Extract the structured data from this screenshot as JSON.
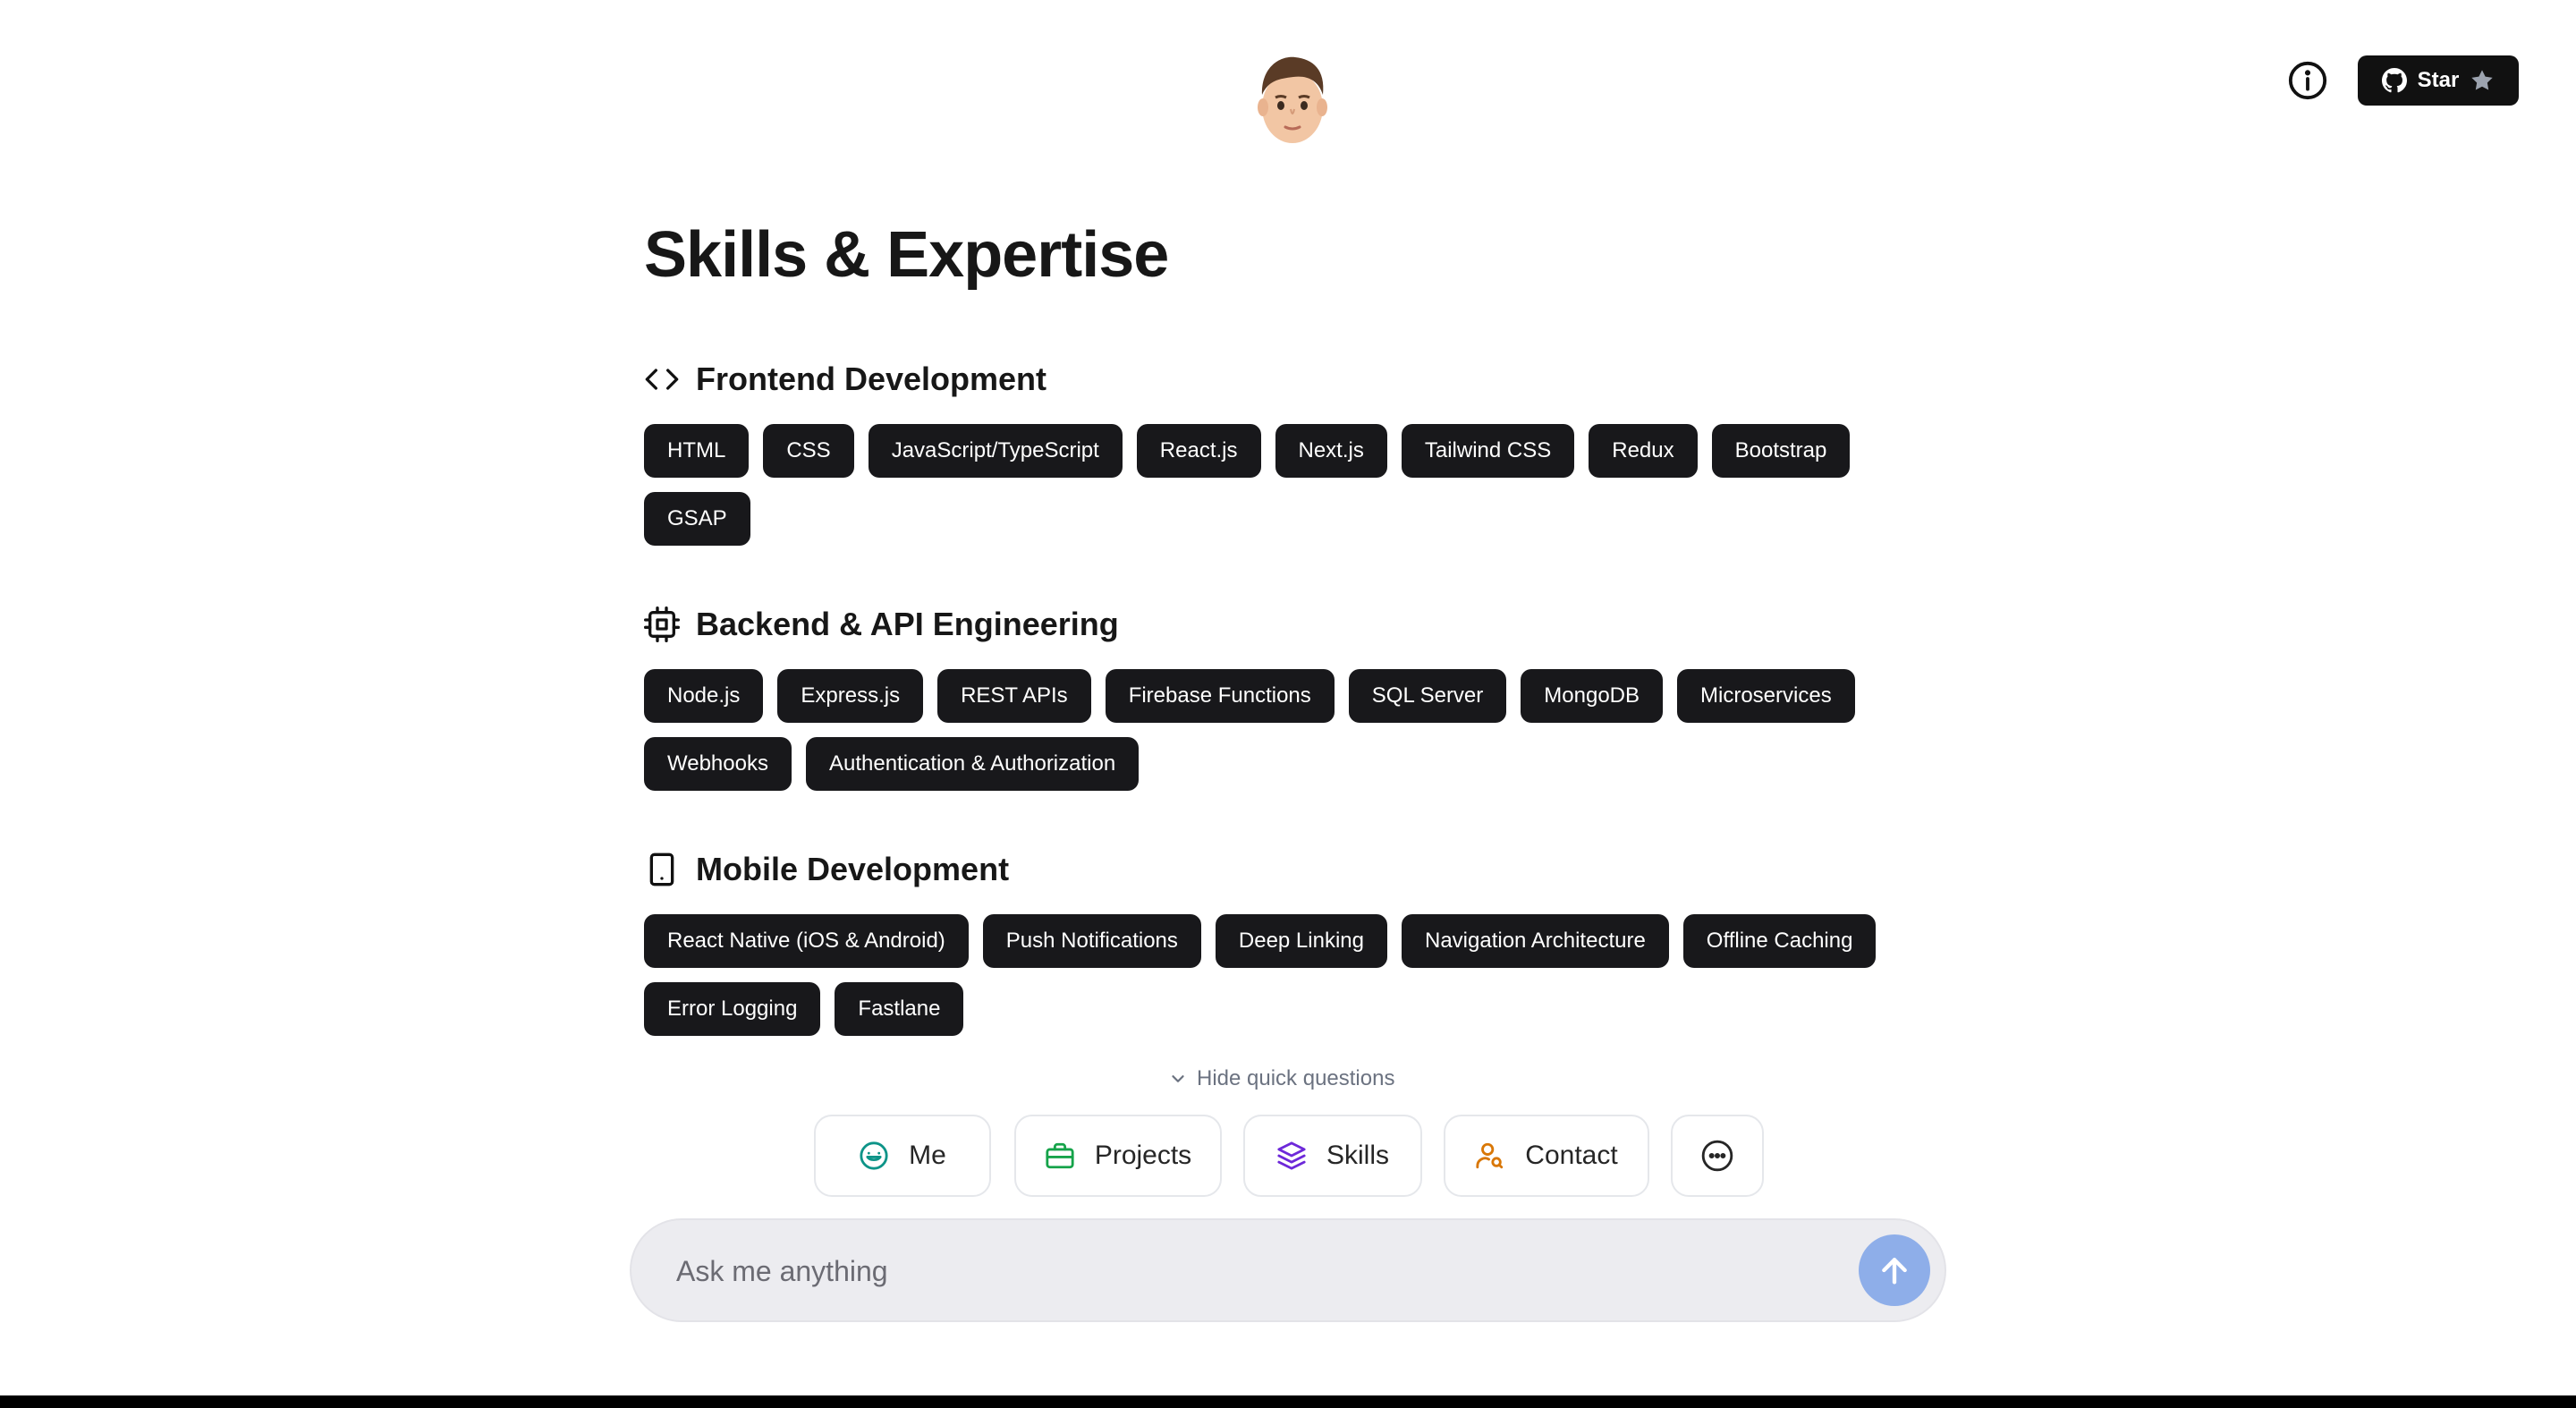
{
  "header": {
    "star_label": "Star",
    "icons": {
      "info": "info-icon",
      "github": "github-icon",
      "star": "star-icon",
      "avatar": "memoji-avatar"
    }
  },
  "page": {
    "title": "Skills & Expertise"
  },
  "sections": [
    {
      "title": "Frontend Development",
      "icon": "code-icon",
      "skills": [
        "HTML",
        "CSS",
        "JavaScript/TypeScript",
        "React.js",
        "Next.js",
        "Tailwind CSS",
        "Redux",
        "Bootstrap",
        "GSAP"
      ]
    },
    {
      "title": "Backend & API Engineering",
      "icon": "cpu-icon",
      "skills": [
        "Node.js",
        "Express.js",
        "REST APIs",
        "Firebase Functions",
        "SQL Server",
        "MongoDB",
        "Microservices",
        "Webhooks",
        "Authentication & Authorization"
      ]
    },
    {
      "title": "Mobile Development",
      "icon": "tablet-icon",
      "skills": [
        "React Native (iOS & Android)",
        "Push Notifications",
        "Deep Linking",
        "Navigation Architecture",
        "Offline Caching",
        "Error Logging",
        "Fastlane"
      ]
    }
  ],
  "quick": {
    "toggle_label": "Hide quick questions",
    "buttons": [
      {
        "label": "Me",
        "icon": "smile-icon",
        "color": "#0d9488"
      },
      {
        "label": "Projects",
        "icon": "briefcase-icon",
        "color": "#16a34a"
      },
      {
        "label": "Skills",
        "icon": "layers-icon",
        "color": "#6d28d9"
      },
      {
        "label": "Contact",
        "icon": "user-search-icon",
        "color": "#d97706"
      }
    ],
    "more_icon": "more-icon"
  },
  "input": {
    "placeholder": "Ask me anything",
    "send_icon": "arrow-up-icon",
    "send_color": "#8eaee9"
  }
}
